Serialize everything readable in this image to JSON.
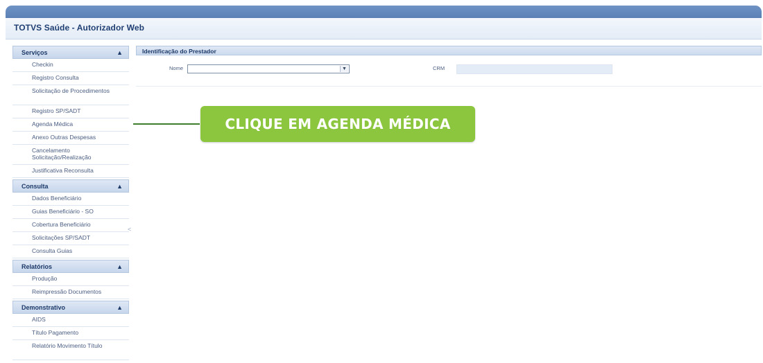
{
  "app": {
    "title": "TOTVS Saúde - Autorizador Web"
  },
  "sidebar": {
    "sections": [
      {
        "title": "Serviços",
        "items": [
          "Checkin",
          "Registro Consulta",
          "Solicitação de Procedimentos",
          "Registro SP/SADT",
          "Agenda Médica",
          "Anexo Outras Despesas",
          "Cancelamento Solicitação/Realização",
          "Justificativa Reconsulta"
        ]
      },
      {
        "title": "Consulta",
        "items": [
          "Dados Beneficiário",
          "Guias Beneficiário - SO",
          "Cobertura Beneficiário",
          "Solicitações SP/SADT",
          "Consulta Guias"
        ]
      },
      {
        "title": "Relatórios",
        "items": [
          "Produção",
          "Reimpressão Documentos"
        ]
      },
      {
        "title": "Demonstrativo",
        "items": [
          "AIDS",
          "Título Pagamento",
          "Relatório Movimento Título"
        ]
      }
    ],
    "collapse_glyph": "<",
    "section_chevron": "▲"
  },
  "main": {
    "section_title": "Identificação do Prestador",
    "nome_label": "Nome",
    "nome_value": "",
    "crm_label": "CRM",
    "crm_value": "",
    "select_arrow": "▼"
  },
  "callout": {
    "text": "CLIQUE EM AGENDA MÉDICA",
    "color": "#8cc63e",
    "line_color": "#3f7f2c"
  },
  "colors": {
    "topbar": "#5a80b6",
    "header_text": "#1d3968"
  }
}
